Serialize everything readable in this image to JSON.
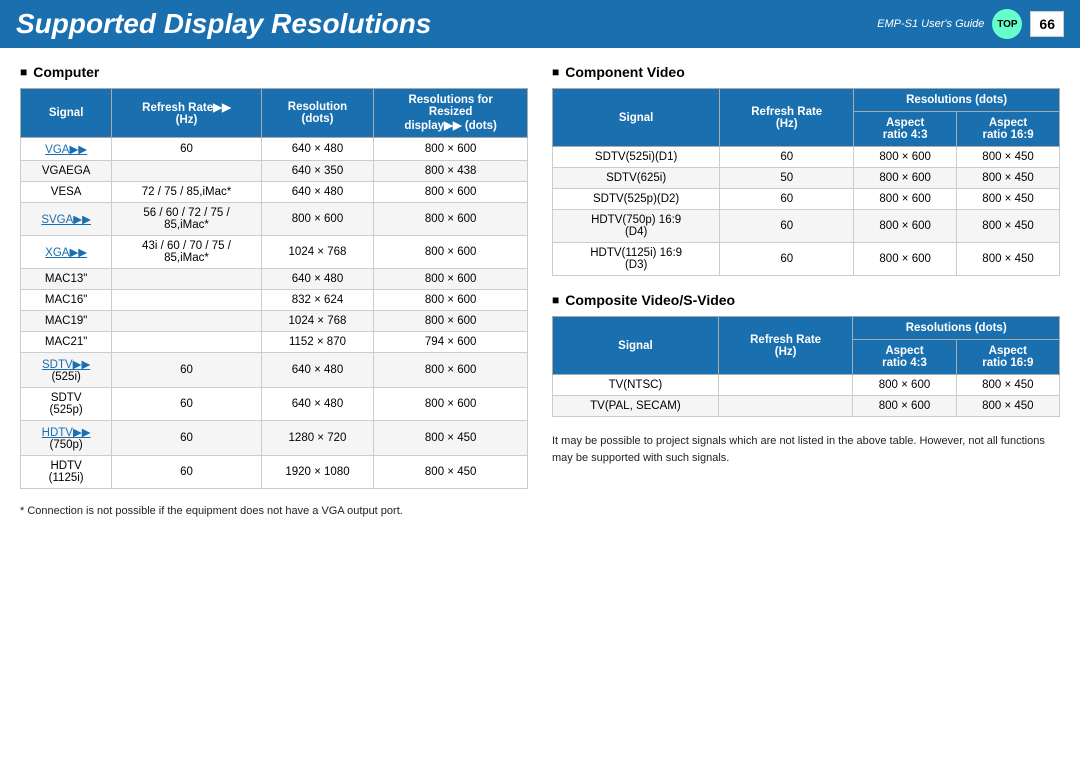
{
  "header": {
    "title": "Supported Display Resolutions",
    "guide": "EMP-S1 User's Guide",
    "top": "TOP",
    "page": "66"
  },
  "computer_section": {
    "title": "Computer",
    "columns": [
      "Signal",
      "Refresh Rate▶▶\n(Hz)",
      "Resolution\n(dots)",
      "Resolutions for Resized\ndisplay▶▶ (dots)"
    ],
    "rows": [
      {
        "signal": "VGA▶▶",
        "link": true,
        "hz": "60",
        "res": "640 × 480",
        "resized": "800 × 600"
      },
      {
        "signal": "VGAEGA",
        "link": false,
        "hz": "",
        "res": "640 × 350",
        "resized": "800 × 438"
      },
      {
        "signal": "VESA",
        "link": false,
        "hz": "72 / 75 / 85,iMac*",
        "res": "640 × 480",
        "resized": "800 × 600"
      },
      {
        "signal": "SVGA▶▶",
        "link": true,
        "hz": "56 / 60 / 72 / 75 / 85,iMac*",
        "res": "800 × 600",
        "resized": "800 × 600"
      },
      {
        "signal": "XGA▶▶",
        "link": true,
        "hz": "43i / 60 / 70 / 75 / 85,iMac*",
        "res": "1024 × 768",
        "resized": "800 × 600"
      },
      {
        "signal": "MAC13\"",
        "link": false,
        "hz": "",
        "res": "640 × 480",
        "resized": "800 × 600"
      },
      {
        "signal": "MAC16\"",
        "link": false,
        "hz": "",
        "res": "832 × 624",
        "resized": "800 × 600"
      },
      {
        "signal": "MAC19\"",
        "link": false,
        "hz": "",
        "res": "1024 × 768",
        "resized": "800 × 600"
      },
      {
        "signal": "MAC21\"",
        "link": false,
        "hz": "",
        "res": "1152 × 870",
        "resized": "794 × 600"
      },
      {
        "signal": "SDTV▶▶\n(525i)",
        "link": true,
        "hz": "60",
        "res": "640 × 480",
        "resized": "800 × 600"
      },
      {
        "signal": "SDTV\n(525p)",
        "link": false,
        "hz": "60",
        "res": "640 × 480",
        "resized": "800 × 600"
      },
      {
        "signal": "HDTV▶▶\n(750p)",
        "link": true,
        "hz": "60",
        "res": "1280 × 720",
        "resized": "800 × 450"
      },
      {
        "signal": "HDTV\n(1125i)",
        "link": false,
        "hz": "60",
        "res": "1920 × 1080",
        "resized": "800 × 450"
      }
    ],
    "footnote": "* Connection is not possible if the equipment does not have a VGA output port."
  },
  "component_section": {
    "title": "Component Video",
    "columns": [
      "Signal",
      "Refresh Rate\n(Hz)",
      "Aspect\nratio 4:3",
      "Aspect\nratio 16:9"
    ],
    "col_header_span": "Resolutions (dots)",
    "rows": [
      {
        "signal": "SDTV(525i)(D1)",
        "hz": "60",
        "ar43": "800 × 600",
        "ar169": "800 × 450"
      },
      {
        "signal": "SDTV(625i)",
        "hz": "50",
        "ar43": "800 × 600",
        "ar169": "800 × 450"
      },
      {
        "signal": "SDTV(525p)(D2)",
        "hz": "60",
        "ar43": "800 × 600",
        "ar169": "800 × 450"
      },
      {
        "signal": "HDTV(750p) 16:9\n(D4)",
        "hz": "60",
        "ar43": "800 × 600",
        "ar169": "800 × 450"
      },
      {
        "signal": "HDTV(1125i) 16:9\n(D3)",
        "hz": "60",
        "ar43": "800 × 600",
        "ar169": "800 × 450"
      }
    ]
  },
  "composite_section": {
    "title": "Composite Video/S-Video",
    "columns": [
      "Signal",
      "Refresh Rate\n(Hz)",
      "Aspect\nratio 4:3",
      "Aspect\nratio 16:9"
    ],
    "col_header_span": "Resolutions (dots)",
    "rows": [
      {
        "signal": "TV(NTSC)",
        "hz": "",
        "ar43": "800 × 600",
        "ar169": "800 × 450"
      },
      {
        "signal": "TV(PAL, SECAM)",
        "hz": "",
        "ar43": "800 × 600",
        "ar169": "800 × 450"
      }
    ]
  },
  "note": "It may be possible to project signals which are not listed in the above table. However, not all functions may be supported with such signals."
}
